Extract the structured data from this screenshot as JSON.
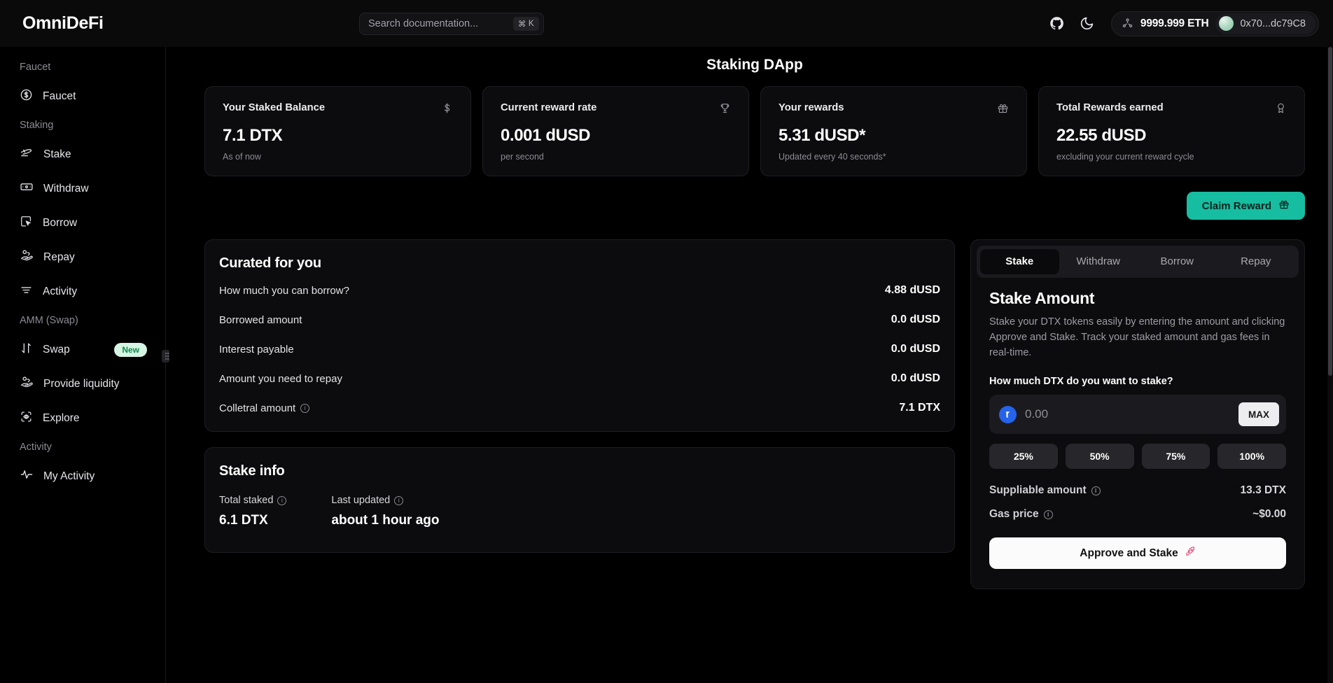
{
  "app": {
    "brand": "OmniDeFi"
  },
  "search": {
    "placeholder": "Search documentation...",
    "shortcut_mod": "⌘",
    "shortcut_key": "K"
  },
  "topbar": {
    "github_icon": "github-icon",
    "theme_icon": "moon-icon",
    "network_icon": "network-nodes-icon",
    "balance": "9999.999 ETH",
    "address": "0x70...dc79C8"
  },
  "sidebar": {
    "groups": [
      {
        "label": "Faucet",
        "items": [
          {
            "label": "Faucet",
            "icon": "dollar-circle-icon"
          }
        ]
      },
      {
        "label": "Staking",
        "items": [
          {
            "label": "Stake",
            "icon": "send-plane-icon"
          },
          {
            "label": "Withdraw",
            "icon": "banknote-icon"
          },
          {
            "label": "Borrow",
            "icon": "cursor-box-icon"
          },
          {
            "label": "Repay",
            "icon": "hand-coins-icon"
          },
          {
            "label": "Activity",
            "icon": "list-lines-icon"
          }
        ]
      },
      {
        "label": "AMM (Swap)",
        "items": [
          {
            "label": "Swap",
            "icon": "arrows-up-down-icon",
            "badge": "New"
          },
          {
            "label": "Provide liquidity",
            "icon": "hand-coins-icon"
          },
          {
            "label": "Explore",
            "icon": "scan-eye-icon"
          }
        ]
      },
      {
        "label": "Activity",
        "items": [
          {
            "label": "My Activity",
            "icon": "pulse-icon"
          }
        ]
      }
    ]
  },
  "page": {
    "title": "Staking DApp"
  },
  "stats": [
    {
      "label": "Your Staked Balance",
      "icon": "dollar-icon",
      "value": "7.1 DTX",
      "sub": "As of now"
    },
    {
      "label": "Current reward rate",
      "icon": "trophy-icon",
      "value": "0.001 dUSD",
      "sub": "per second"
    },
    {
      "label": "Your rewards",
      "icon": "gift-icon",
      "value": "5.31 dUSD*",
      "sub": "Updated every 40 seconds*"
    },
    {
      "label": "Total Rewards earned",
      "icon": "award-icon",
      "value": "22.55 dUSD",
      "sub": "excluding your current reward cycle"
    }
  ],
  "claim": {
    "label": "Claim Reward",
    "icon": "gift-icon"
  },
  "curated": {
    "title": "Curated for you",
    "rows": [
      {
        "key": "How much you can borrow?",
        "value": "4.88 dUSD",
        "info": false
      },
      {
        "key": "Borrowed amount",
        "value": "0.0 dUSD",
        "info": false
      },
      {
        "key": "Interest payable",
        "value": "0.0 dUSD",
        "info": false
      },
      {
        "key": "Amount you need to repay",
        "value": "0.0 dUSD",
        "info": false
      },
      {
        "key": "Colletral amount",
        "value": "7.1 DTX",
        "info": true
      }
    ]
  },
  "stake_info": {
    "title": "Stake info",
    "items": [
      {
        "key": "Total staked",
        "value": "6.1 DTX",
        "info": true
      },
      {
        "key": "Last updated",
        "value": "about 1 hour ago",
        "info": true
      }
    ]
  },
  "stake_panel": {
    "tabs": [
      {
        "label": "Stake",
        "active": true
      },
      {
        "label": "Withdraw",
        "active": false
      },
      {
        "label": "Borrow",
        "active": false
      },
      {
        "label": "Repay",
        "active": false
      }
    ],
    "heading": "Stake Amount",
    "description": "Stake your DTX tokens easily by entering the amount and clicking Approve and Stake. Track your staked amount and gas fees in real-time.",
    "field_label": "How much DTX do you want to stake?",
    "amount_value": "",
    "amount_placeholder": "0.00",
    "max_label": "MAX",
    "percents": [
      "25%",
      "50%",
      "75%",
      "100%"
    ],
    "suppliable_label": "Suppliable amount",
    "suppliable_value": "13.3 DTX",
    "gas_label": "Gas price",
    "gas_value": "~$0.00",
    "submit_label": "Approve and Stake",
    "submit_icon": "rocket-icon"
  },
  "colors": {
    "accent": "#17bda0",
    "badge_bg": "#d6f5e3",
    "badge_text": "#0f8a4d",
    "token_blue": "#2563eb"
  }
}
